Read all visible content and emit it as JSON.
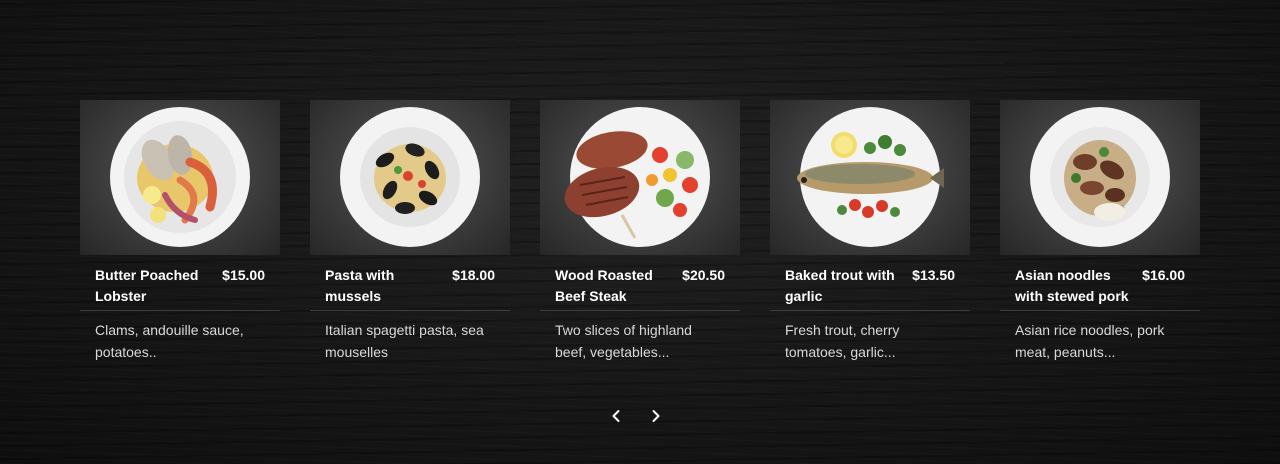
{
  "menu": {
    "items": [
      {
        "name": "Butter Poached Lobster",
        "price": "$15.00",
        "description": "Clams, andouille sauce, potatoes..",
        "icon": "lobster-dish-photo"
      },
      {
        "name": "Pasta with mussels",
        "price": "$18.00",
        "description": "Italian spagetti pasta, sea mouselles",
        "icon": "mussels-pasta-photo"
      },
      {
        "name": "Wood Roasted Beef Steak",
        "price": "$20.50",
        "description": "Two slices of highland beef, vegetables...",
        "icon": "beef-steak-photo"
      },
      {
        "name": "Baked trout with garlic",
        "price": "$13.50",
        "description": "Fresh trout, cherry tomatoes, garlic...",
        "icon": "baked-trout-photo"
      },
      {
        "name": "Asian noodles with stewed pork",
        "price": "$16.00",
        "description": "Asian rice noodles, pork meat, peanuts...",
        "icon": "asian-noodles-photo"
      }
    ]
  },
  "nav": {
    "prev_icon": "chevron-left-icon",
    "next_icon": "chevron-right-icon"
  },
  "colors": {
    "background": "#161616",
    "text": "#ffffff",
    "muted_text": "#d9d9d9",
    "divider": "#3d3d3d"
  }
}
